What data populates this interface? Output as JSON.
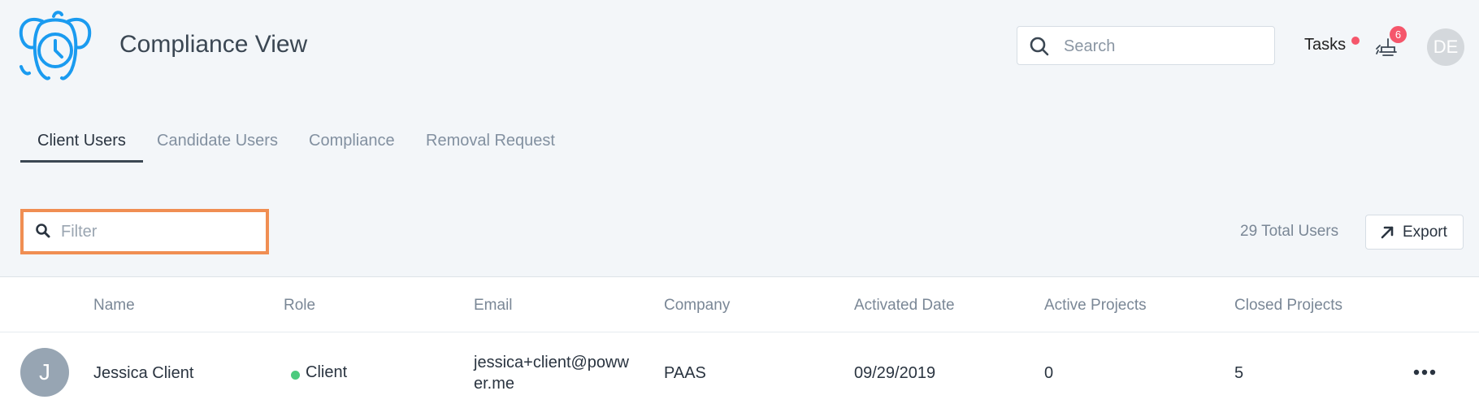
{
  "header": {
    "app_title": "Compliance View",
    "search_placeholder": "Search",
    "tasks_label": "Tasks",
    "notification_count": "6",
    "user_initials": "DE"
  },
  "tabs": [
    {
      "label": "Client Users",
      "active": true
    },
    {
      "label": "Candidate Users",
      "active": false
    },
    {
      "label": "Compliance",
      "active": false
    },
    {
      "label": "Removal Request",
      "active": false
    }
  ],
  "toolbar": {
    "filter_placeholder": "Filter",
    "total_users": "29 Total Users",
    "export_label": "Export"
  },
  "table": {
    "columns": [
      "Name",
      "Role",
      "Email",
      "Company",
      "Activated Date",
      "Active Projects",
      "Closed Projects"
    ],
    "rows": [
      {
        "initial": "J",
        "name": "Jessica Client",
        "role": "Client",
        "email_line1": "jessica+client@poww",
        "email_line2": "er.me",
        "company": "PAAS",
        "activated_date": "09/29/2019",
        "active_projects": "0",
        "closed_projects": "5"
      }
    ]
  },
  "colors": {
    "accent_blue": "#1a9bf0",
    "highlight_orange": "#f08e53",
    "badge_red": "#f5566b",
    "status_green": "#4ccb7e"
  },
  "icons": {
    "logo": "elephant-clock-logo",
    "search": "search-icon",
    "filter": "search-icon",
    "notifications": "hand-bell-icon",
    "export": "arrow-up-right-icon",
    "row_actions": "more-horizontal-icon"
  }
}
